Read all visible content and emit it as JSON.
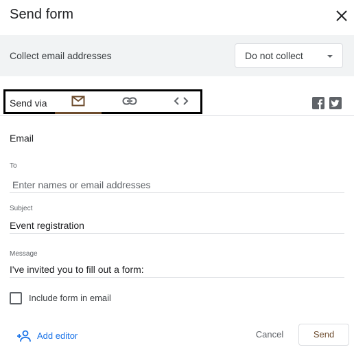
{
  "dialog": {
    "title": "Send form",
    "close_icon": "close-icon"
  },
  "collect": {
    "label": "Collect email addresses",
    "selected": "Do not collect"
  },
  "send_via": {
    "label": "Send via",
    "tabs": [
      {
        "icon": "email-icon",
        "active": true
      },
      {
        "icon": "link-icon",
        "active": false
      },
      {
        "icon": "embed-code-icon",
        "active": false
      }
    ],
    "social": [
      "facebook-icon",
      "twitter-icon"
    ]
  },
  "email": {
    "section_title": "Email",
    "to": {
      "label": "To",
      "placeholder": "Enter names or email addresses",
      "value": ""
    },
    "subject": {
      "label": "Subject",
      "value": "Event registration"
    },
    "message": {
      "label": "Message",
      "value": "I've invited you to fill out a form:"
    },
    "include_form": {
      "label": "Include form in email",
      "checked": false
    }
  },
  "footer": {
    "add_editor": "Add editor",
    "cancel": "Cancel",
    "send": "Send"
  },
  "colors": {
    "accent": "#6d4c2e",
    "link": "#1a73e8",
    "gray_bar": "#f1f3f4"
  }
}
